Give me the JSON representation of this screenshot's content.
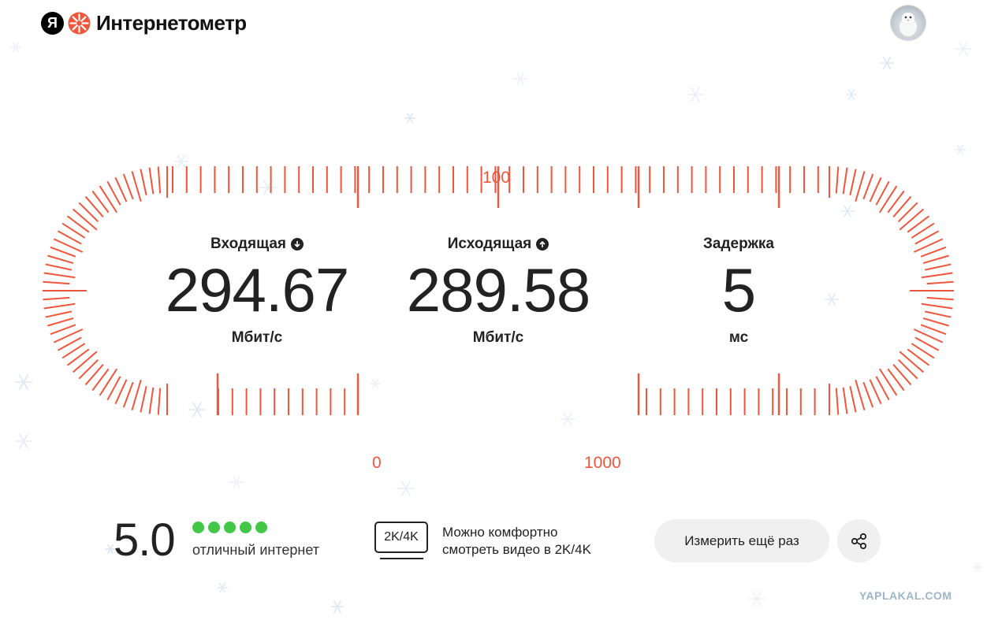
{
  "header": {
    "logo_letter": "Я",
    "app_title": "Интернетометр"
  },
  "metrics": {
    "download": {
      "label": "Входящая",
      "value": "294.67",
      "unit": "Мбит/с"
    },
    "upload": {
      "label": "Исходящая",
      "value": "289.58",
      "unit": "Мбит/с"
    },
    "latency": {
      "label": "Задержка",
      "value": "5",
      "unit": "мс"
    }
  },
  "scale": {
    "label_0": "0",
    "label_100": "100",
    "label_1000": "1000"
  },
  "rating": {
    "value": "5.0",
    "stars_filled": 5,
    "stars_total": 5,
    "caption": "отличный интернет"
  },
  "video": {
    "badge": "2K/4K",
    "text_line1": "Можно комфортно",
    "text_line2": "смотреть видео в 2K/4K"
  },
  "actions": {
    "remeasure_label": "Измерить ещё раз"
  },
  "watermark": "YAPLAKAL.COM",
  "colors": {
    "accent": "#f0563c",
    "good": "#43c748",
    "text": "#222222"
  },
  "icons": {
    "download_icon": "arrow-down-circle-icon",
    "upload_icon": "arrow-up-circle-icon",
    "share_icon": "share-nodes-icon"
  }
}
